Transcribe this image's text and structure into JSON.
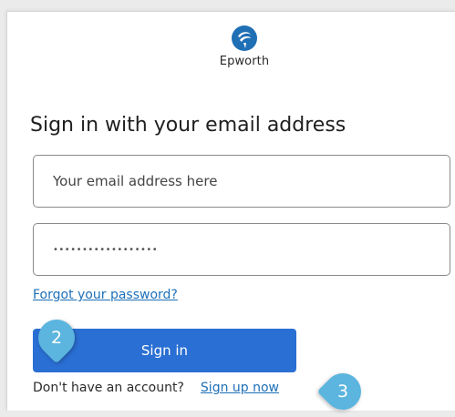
{
  "brand": {
    "name": "Epworth",
    "logo_icon": "epworth-logo-icon",
    "logo_color": "#1f6fb5"
  },
  "heading": "Sign in with your email address",
  "email": {
    "placeholder": "Your email address here",
    "value": ""
  },
  "password": {
    "value": "••••••••••••••••••"
  },
  "forgot_password_link": "Forgot your password?",
  "signin_button": "Sign in",
  "signup": {
    "prompt": "Don't have an account?",
    "link": "Sign up now"
  },
  "callouts": {
    "signin_step": "2",
    "signup_step": "3"
  },
  "colors": {
    "primary_button": "#2a6fd3",
    "link": "#1d6fb8",
    "callout": "#5bb5de"
  }
}
